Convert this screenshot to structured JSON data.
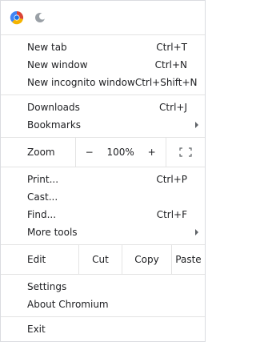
{
  "header": {
    "icons": [
      "chromium-icon",
      "moon-icon"
    ]
  },
  "menu": {
    "new_tab": {
      "label": "New tab",
      "shortcut": "Ctrl+T"
    },
    "new_window": {
      "label": "New window",
      "shortcut": "Ctrl+N"
    },
    "new_incognito": {
      "label": "New incognito window",
      "shortcut": "Ctrl+Shift+N"
    },
    "downloads": {
      "label": "Downloads",
      "shortcut": "Ctrl+J"
    },
    "bookmarks": {
      "label": "Bookmarks"
    },
    "zoom": {
      "label": "Zoom",
      "minus": "−",
      "value": "100%",
      "plus": "+"
    },
    "print": {
      "label": "Print...",
      "shortcut": "Ctrl+P"
    },
    "cast": {
      "label": "Cast..."
    },
    "find": {
      "label": "Find...",
      "shortcut": "Ctrl+F"
    },
    "more_tools": {
      "label": "More tools"
    },
    "edit": {
      "label": "Edit",
      "cut": "Cut",
      "copy": "Copy",
      "paste": "Paste"
    },
    "settings": {
      "label": "Settings"
    },
    "about": {
      "label": "About Chromium"
    },
    "exit": {
      "label": "Exit"
    }
  }
}
